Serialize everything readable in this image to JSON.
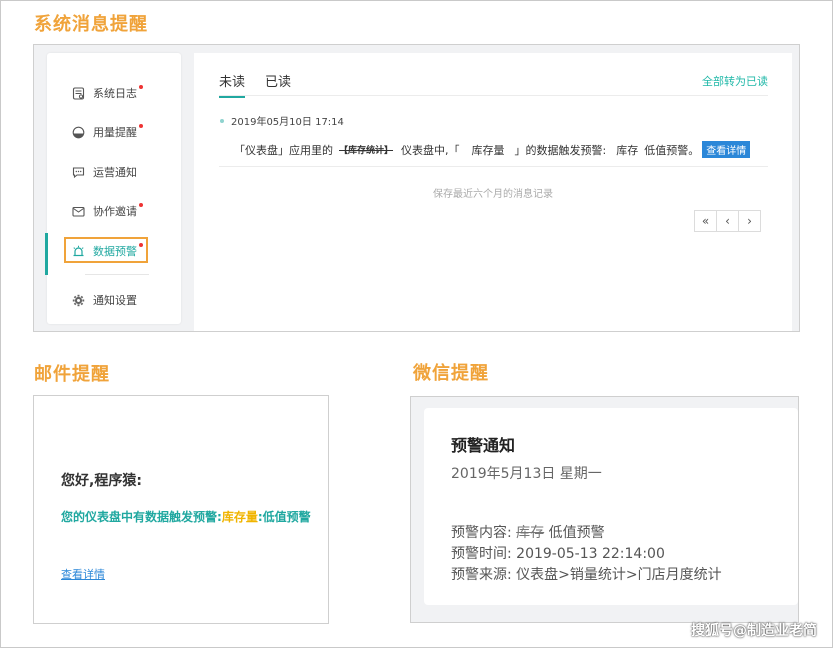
{
  "sections": {
    "system_title": "系统消息提醒",
    "mail_title": "邮件提醒",
    "wechat_title": "微信提醒"
  },
  "sidebar": {
    "items": [
      {
        "label": "系统日志",
        "icon": "log-icon",
        "unread": true
      },
      {
        "label": "用量提醒",
        "icon": "usage-icon",
        "unread": true
      },
      {
        "label": "运营通知",
        "icon": "chat-icon",
        "unread": false
      },
      {
        "label": "协作邀请",
        "icon": "mail-icon",
        "unread": true
      },
      {
        "label": "数据预警",
        "icon": "alarm-icon",
        "unread": true,
        "active": true
      },
      {
        "label": "通知设置",
        "icon": "gear-icon",
        "unread": false
      }
    ]
  },
  "tabs": {
    "unread": "未读",
    "read": "已读",
    "mark_all": "全部转为已读"
  },
  "message": {
    "time": "2019年05月10日 17:14",
    "part1": "「仪表盘」应用里的",
    "strike": "【库存统计】",
    "part2": "仪表盘中,「",
    "keyword": "库存量",
    "part3": "」的数据触发预警:",
    "part4": "库存",
    "part5": "低值预警。",
    "view_label": "查看详情"
  },
  "keep_note": "保存最近六个月的消息记录",
  "pager": {
    "first": "«",
    "prev": "‹",
    "next": "›"
  },
  "mail": {
    "greeting": "您好,程序猿:",
    "line_prefix": "您的仪表盘中有数据触发预警:",
    "keyword": "库存量",
    "line_suffix": ":低值预警",
    "link": "查看详情"
  },
  "wechat": {
    "title": "预警通知",
    "date": "2019年5月13日 星期一",
    "content_label": "预警内容:",
    "content_strike": "库存",
    "content_value": "低值预警",
    "time_label": "预警时间:",
    "time_value": "2019-05-13 22:14:00",
    "source_label": "预警来源:",
    "source_value": "仪表盘>销量统计>门店月度统计"
  },
  "watermark": "搜狐号@制造业老简",
  "colors": {
    "accent": "#20a8a0",
    "highlight": "#f0a33a",
    "link": "#2b87d8",
    "dot": "#e33333"
  }
}
